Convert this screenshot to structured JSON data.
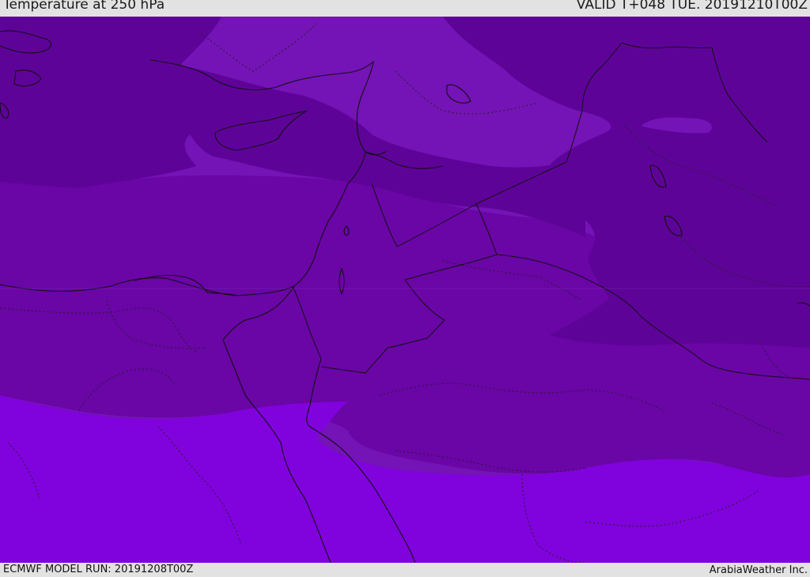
{
  "header": {
    "title": "Temperature at 250 hPa",
    "valid": "VALID T+048 TUE. 20191210T00Z"
  },
  "footer": {
    "model_run": "ECMWF MODEL RUN: 20191208T00Z",
    "provider": "ArabiaWeather Inc."
  },
  "map": {
    "variable": "temperature",
    "level": "250 hPa",
    "shading_colors": {
      "darkest": "#5e0398",
      "dark": "#6a05a6",
      "medium": "#7413b6",
      "light": "#8002dc"
    },
    "boundary_color": "#111111"
  }
}
